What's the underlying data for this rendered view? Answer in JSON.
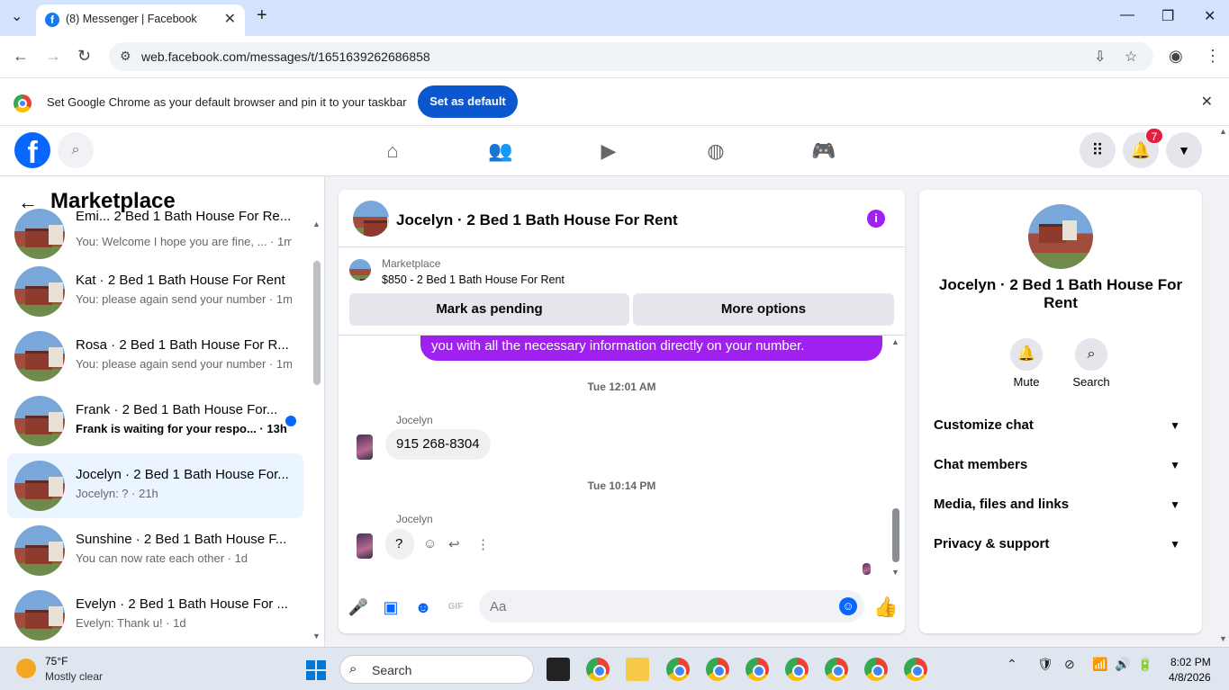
{
  "browser": {
    "tab_title": "(8) Messenger | Facebook",
    "url": "web.facebook.com/messages/t/1651639262686858",
    "banner_text": "Set Google Chrome as your default browser and pin it to your taskbar",
    "banner_button": "Set as default"
  },
  "fb_nav": {
    "notification_count": "7"
  },
  "sidebar": {
    "title": "Marketplace",
    "conversations": [
      {
        "name": "Emi... 2 Bed 1 Bath House For Re...",
        "snippet": "You: Welcome I hope you are fine, ... · 1m",
        "unread": false,
        "selected": false
      },
      {
        "name": "Kat · 2 Bed 1 Bath House For Rent",
        "snippet": "You: please again send your number · 1m",
        "unread": false,
        "selected": false
      },
      {
        "name": "Rosa · 2 Bed 1 Bath House For R...",
        "snippet": "You: please again send your number · 1m",
        "unread": false,
        "selected": false
      },
      {
        "name": "Frank · 2 Bed 1 Bath House For...",
        "snippet": "Frank is waiting for your respo... · 13h",
        "unread": true,
        "selected": false
      },
      {
        "name": "Jocelyn · 2 Bed 1 Bath House For...",
        "snippet": "Jocelyn: ? · 21h",
        "unread": false,
        "selected": true
      },
      {
        "name": "Sunshine · 2 Bed 1 Bath House F...",
        "snippet": "You can now rate each other · 1d",
        "unread": false,
        "selected": false
      },
      {
        "name": "Evelyn · 2 Bed 1 Bath House For ...",
        "snippet": "Evelyn: Thank u! · 1d",
        "unread": false,
        "selected": false
      }
    ]
  },
  "chat": {
    "title": "Jocelyn · 2 Bed 1 Bath House For Rent",
    "listing_label": "Marketplace",
    "listing_text": "$850 - 2 Bed 1 Bath House For Rent",
    "mark_pending": "Mark as pending",
    "more_options": "More options",
    "outgoing_message": "you with all the necessary information directly on your number.",
    "timestamp1": "Tue 12:01 AM",
    "sender1": "Jocelyn",
    "message1": "915 268-8304",
    "timestamp2": "Tue 10:14 PM",
    "sender2": "Jocelyn",
    "message2": "?",
    "composer_placeholder": "Aa"
  },
  "info_panel": {
    "name": "Jocelyn · 2 Bed 1 Bath House For Rent",
    "mute": "Mute",
    "search": "Search",
    "sections": [
      "Customize chat",
      "Chat members",
      "Media, files and links",
      "Privacy & support"
    ]
  },
  "taskbar": {
    "temperature": "75°F",
    "condition": "Mostly clear",
    "search": "Search",
    "time": "8:02 PM",
    "date": "4/8/2026"
  }
}
